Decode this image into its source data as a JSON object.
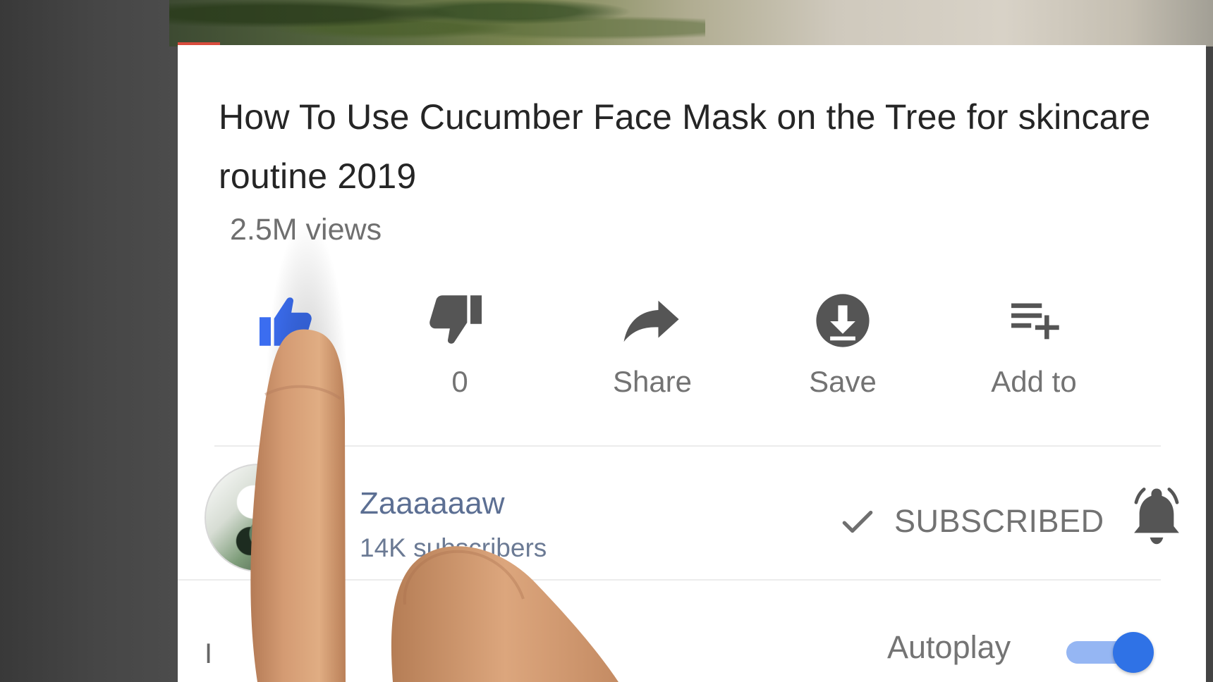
{
  "video": {
    "title": "How To Use Cucumber Face Mask on the Tree for skincare routine 2019",
    "views": "2.5M views"
  },
  "actions": {
    "like": {
      "label": "",
      "icon": "thumbs-up-icon",
      "active_color": "#3b6df0"
    },
    "dislike": {
      "label": "0",
      "icon": "thumbs-down-icon"
    },
    "share": {
      "label": "Share",
      "icon": "share-arrow-icon"
    },
    "save": {
      "label": "Save",
      "icon": "download-icon"
    },
    "add_to": {
      "label": "Add to",
      "icon": "playlist-add-icon"
    }
  },
  "channel": {
    "name": "Zaaaaaaw",
    "subscribers": "14K subscribers",
    "subscription_status": "SUBSCRIBED",
    "notification_icon": "bell-icon"
  },
  "up_next": {
    "fragment": "I"
  },
  "autoplay": {
    "label": "Autoplay",
    "enabled": true,
    "accent": "#2f72e6"
  }
}
